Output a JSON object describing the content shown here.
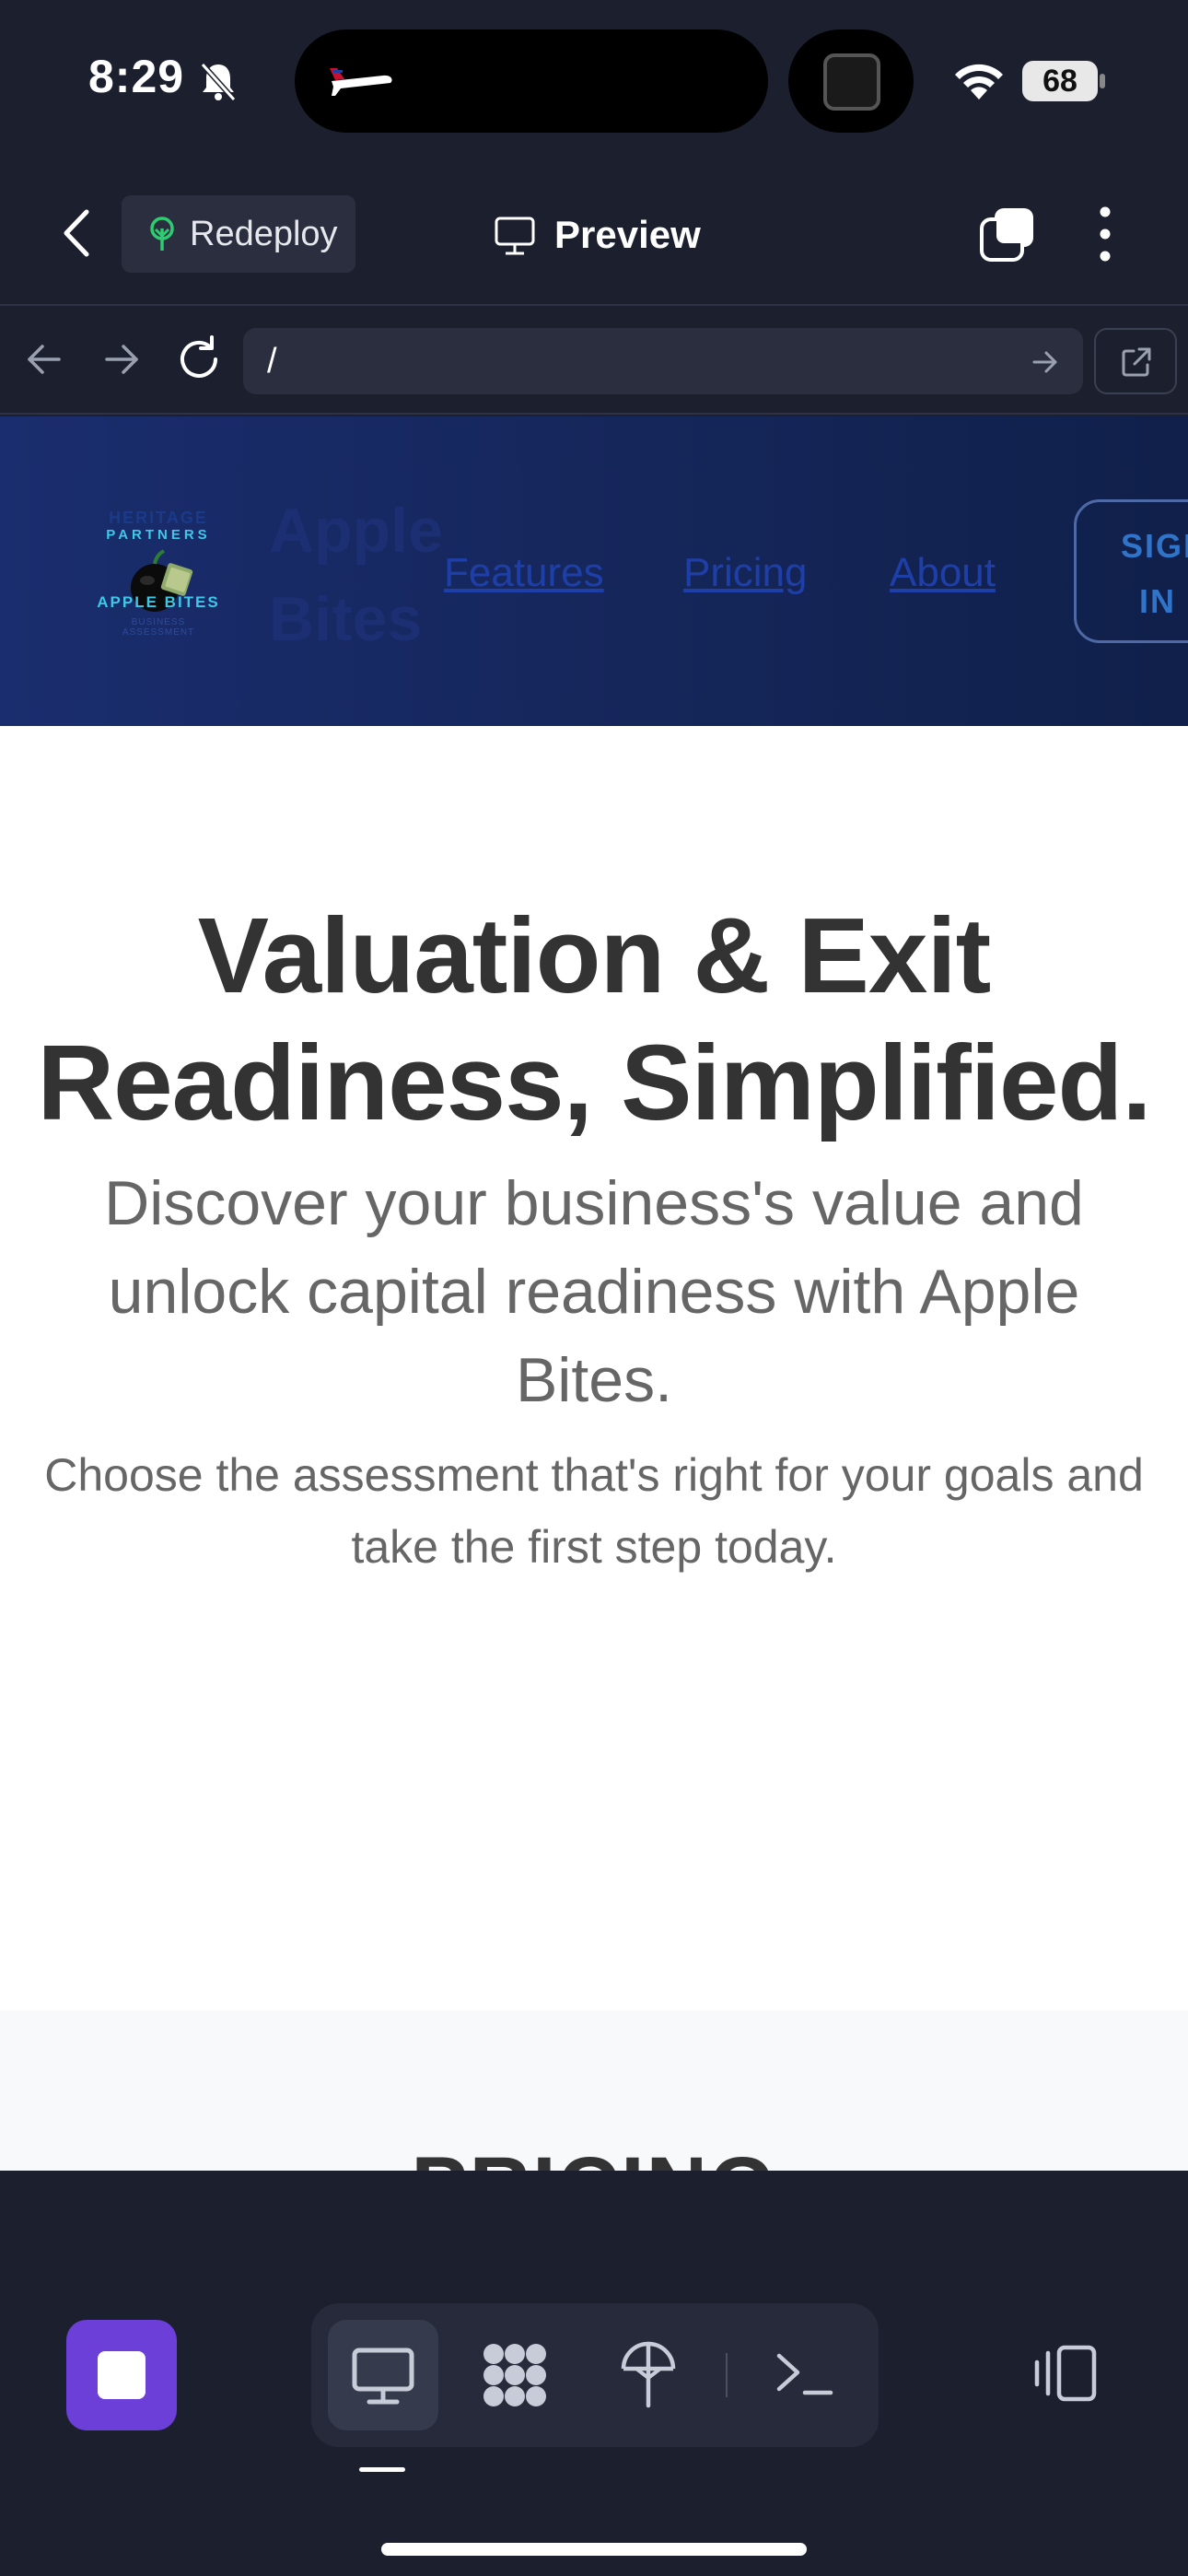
{
  "status_bar": {
    "time": "8:29",
    "battery": "68"
  },
  "app_header": {
    "redeploy_label": "Redeploy",
    "title": "Preview"
  },
  "browser": {
    "url": "/"
  },
  "site": {
    "logo_text": {
      "line1": "HERITAGE",
      "line2": "PARTNERS",
      "line3": "APPLE BITES",
      "line4": "BUSINESS ASSESSMENT"
    },
    "brand_line1": "Apple",
    "brand_line2": "Bites",
    "nav": [
      "Features",
      "Pricing",
      "About"
    ],
    "signin_line1": "SIGN",
    "signin_line2": "IN",
    "hero_title_line1": "Valuation & Exit",
    "hero_title_line2": "Readiness, Simplified.",
    "hero_subtitle": "Discover your business's value and unlock capital readiness with Apple Bites.",
    "hero_small": "Choose the assessment that's right for your goals and take the first step today.",
    "pricing_heading": "PRICING"
  },
  "colors": {
    "accent_purple": "#6c3fd8",
    "nav_bg": "#15265a",
    "chrome_bg": "#1c1f2e"
  },
  "icons": [
    "bell-slash-icon",
    "airplane-icon",
    "wifi-icon",
    "chevron-left-icon",
    "tree-icon",
    "monitor-icon",
    "tabs-icon",
    "more-vertical-icon",
    "arrow-left-icon",
    "arrow-right-icon",
    "reload-icon",
    "external-link-icon",
    "stop-icon",
    "grid-icon",
    "antenna-icon",
    "terminal-icon",
    "panels-icon"
  ]
}
